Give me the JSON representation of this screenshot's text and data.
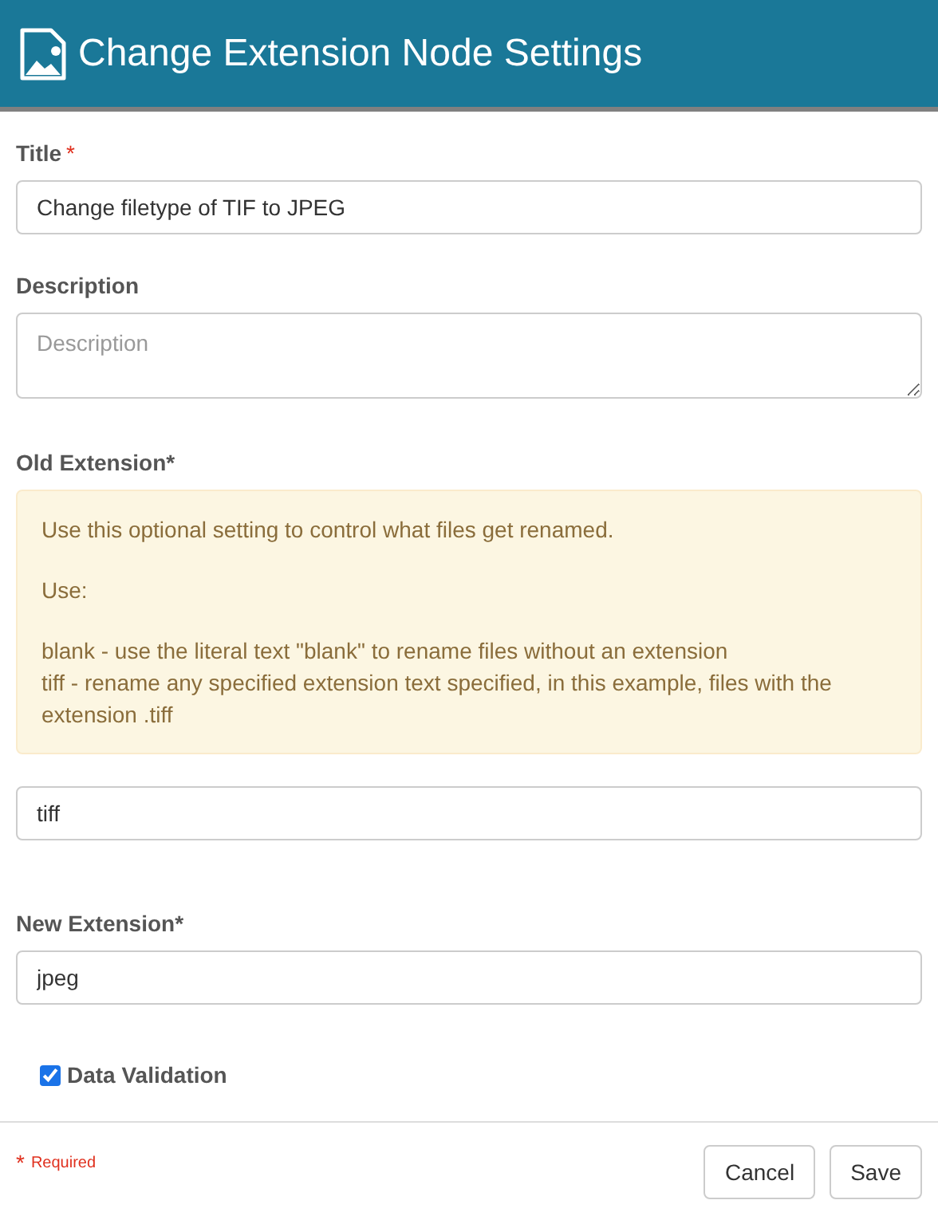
{
  "window": {
    "title": "Change Extension Node Settings"
  },
  "fields": [
    {
      "kind": "input",
      "label": "Title",
      "required_mark": "*",
      "value": "Change filetype of TIF to JPEG"
    },
    {
      "kind": "textarea",
      "label": "Description",
      "placeholder": "Description"
    },
    {
      "kind": "input",
      "label": "Old Extension*",
      "note": [
        [
          "Use this optional setting to control what files get renamed."
        ],
        [
          "Use:"
        ],
        [
          "blank - use the literal text \"blank\" to rename files without an extension",
          "tiff - rename any specified extension text specified, in this example, files with the extension .tiff"
        ]
      ],
      "value": "tiff"
    },
    {
      "kind": "input",
      "label": "New Extension*",
      "value": "jpeg"
    },
    {
      "kind": "checkbox",
      "label": "Data Validation",
      "checked": true
    }
  ],
  "footer": {
    "required_mark": "*",
    "required_text": "Required",
    "buttons": [
      "Cancel",
      "Save"
    ]
  }
}
